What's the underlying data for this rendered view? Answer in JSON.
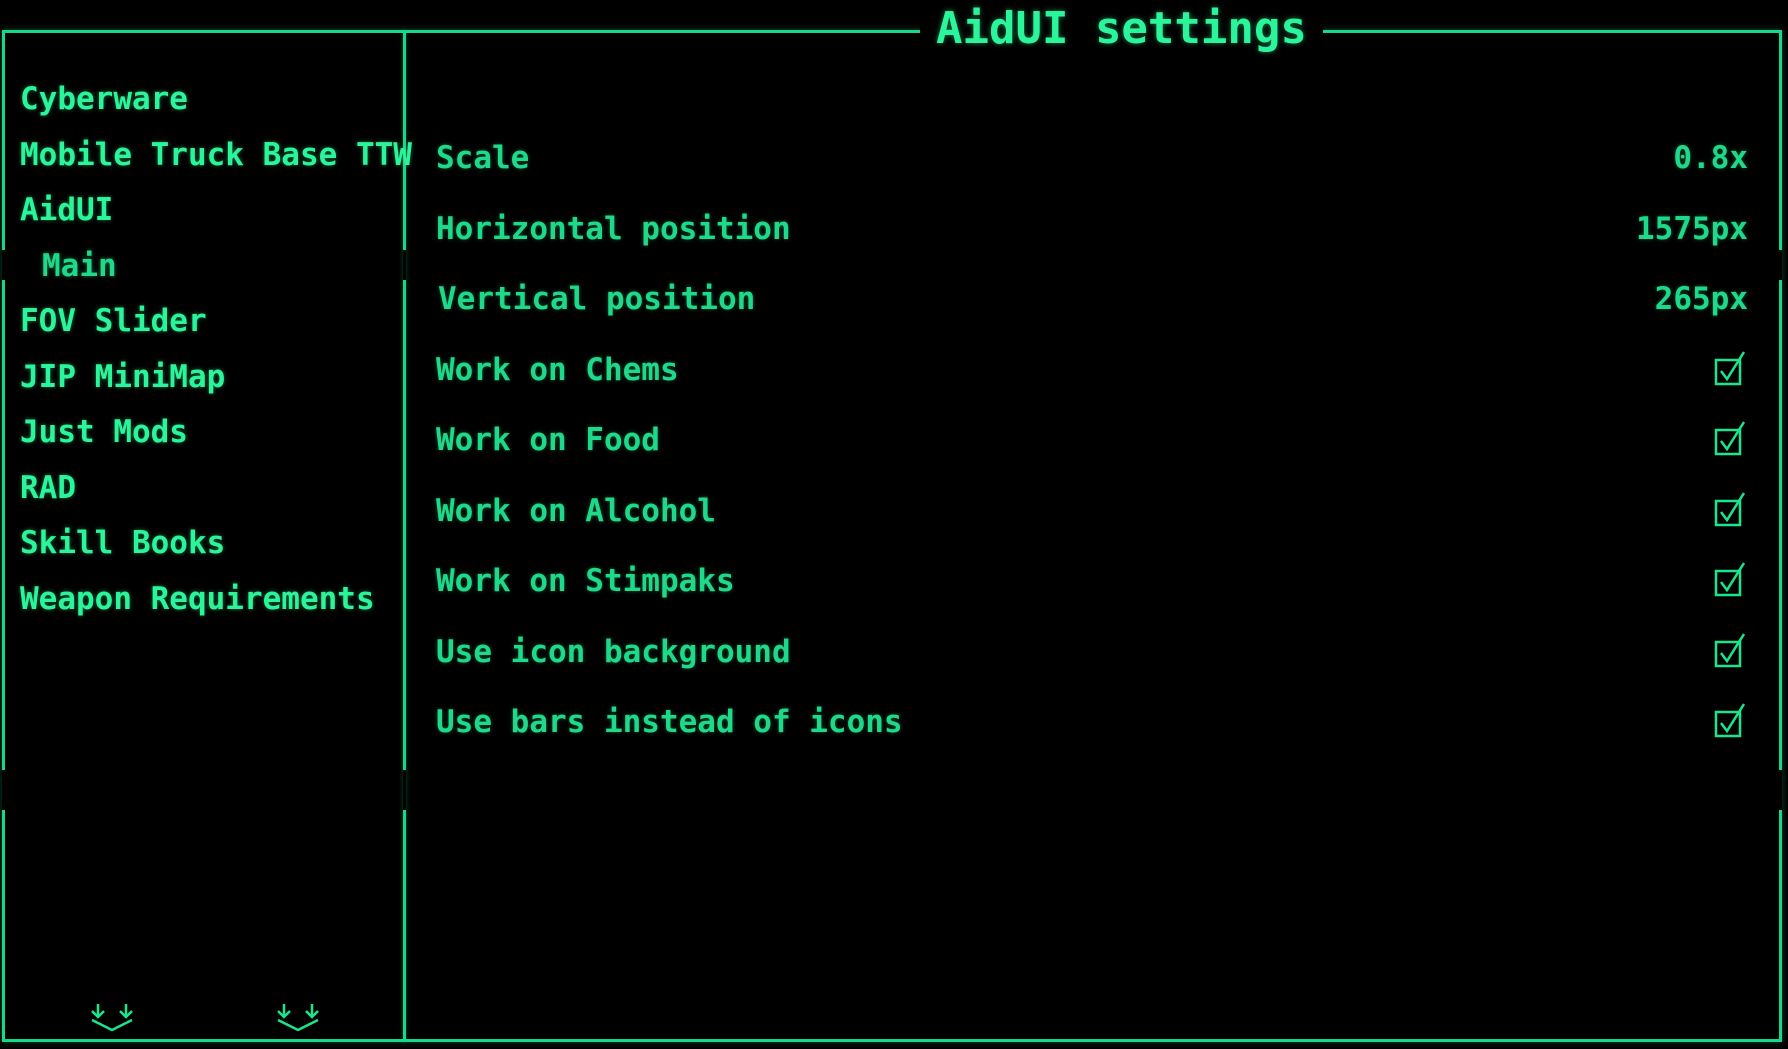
{
  "window": {
    "title": "AidUI settings"
  },
  "sidebar": {
    "items": [
      {
        "label": "Cyberware",
        "sub": false
      },
      {
        "label": "Mobile Truck Base TTW",
        "sub": false
      },
      {
        "label": "AidUI",
        "sub": false
      },
      {
        "label": "Main",
        "sub": true
      },
      {
        "label": "FOV Slider",
        "sub": false
      },
      {
        "label": "JIP MiniMap",
        "sub": false
      },
      {
        "label": "Just Mods",
        "sub": false
      },
      {
        "label": "RAD",
        "sub": false
      },
      {
        "label": "Skill Books",
        "sub": false
      },
      {
        "label": "Weapon Requirements",
        "sub": false
      }
    ],
    "scroll_icons": [
      "scroll-down-icon",
      "scroll-down-icon"
    ]
  },
  "settings": [
    {
      "label": "Scale",
      "value": "0.8x",
      "type": "value"
    },
    {
      "label": "Horizontal position",
      "value": "1575px",
      "type": "value"
    },
    {
      "label": "Vertical position",
      "value": "265px",
      "type": "value"
    },
    {
      "label": "Work on Chems",
      "checked": true,
      "type": "checkbox"
    },
    {
      "label": "Work on Food",
      "checked": true,
      "type": "checkbox"
    },
    {
      "label": "Work on Alcohol",
      "checked": true,
      "type": "checkbox"
    },
    {
      "label": "Work on Stimpaks",
      "checked": true,
      "type": "checkbox"
    },
    {
      "label": "Use icon background",
      "checked": true,
      "type": "checkbox"
    },
    {
      "label": "Use bars instead of icons",
      "checked": true,
      "type": "checkbox"
    }
  ],
  "colors": {
    "accent": "#19e68c",
    "background": "#000000"
  }
}
